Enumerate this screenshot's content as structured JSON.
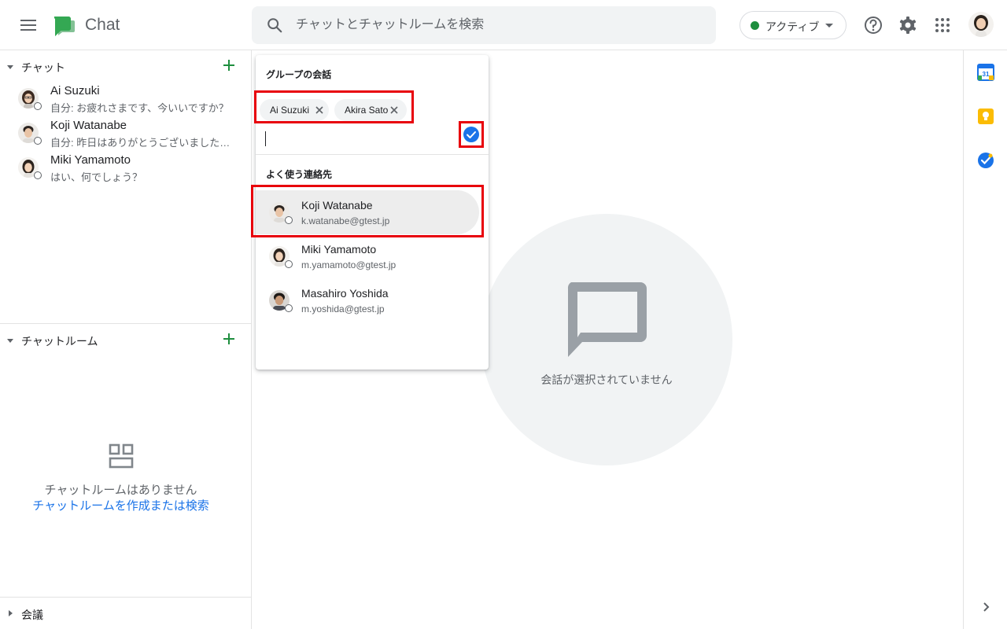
{
  "app": {
    "title": "Chat"
  },
  "search": {
    "placeholder": "チャットとチャットルームを検索"
  },
  "status": {
    "label": "アクティブ",
    "color": "#1e8e3e"
  },
  "icons": {
    "menu": "hamburger-menu-icon",
    "help": "help-icon",
    "settings": "gear-icon",
    "apps": "apps-grid-icon"
  },
  "sidebar": {
    "chats_label": "チャット",
    "chats": [
      {
        "name": "Ai Suzuki",
        "preview": "自分: お疲れさまです、今いいですか？"
      },
      {
        "name": "Koji Watanabe",
        "preview": "自分: 昨日はありがとうございました…"
      },
      {
        "name": "Miki Yamamoto",
        "preview": "はい、何でしょう？"
      }
    ],
    "rooms_label": "チャットルーム",
    "rooms_empty_text": "チャットルームはありません",
    "rooms_empty_link": "チャットルームを作成または検索",
    "meetings_label": "会議"
  },
  "main": {
    "empty_text": "会話が選択されていません"
  },
  "popup": {
    "title": "グループの会話",
    "chips": [
      "Ai Suzuki",
      "Akira Sato"
    ],
    "frequent_label": "よく使う連絡先",
    "contacts": [
      {
        "name": "Koji Watanabe",
        "email": "k.watanabe@gtest.jp"
      },
      {
        "name": "Miki Yamamoto",
        "email": "m.yamamoto@gtest.jp"
      },
      {
        "name": "Masahiro Yoshida",
        "email": "m.yoshida@gtest.jp"
      }
    ]
  },
  "colors": {
    "accent": "#1a73e8",
    "highlight_box": "#e8000b",
    "brand_green": "#1e8e3e"
  }
}
